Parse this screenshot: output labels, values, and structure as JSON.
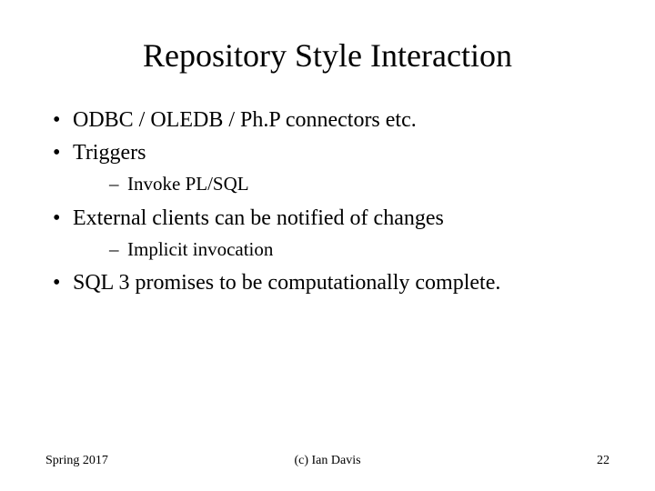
{
  "title": "Repository Style Interaction",
  "bullets": [
    {
      "text": "ODBC / OLEDB / Ph.P connectors etc.",
      "sub": []
    },
    {
      "text": "Triggers",
      "sub": [
        "Invoke PL/SQL"
      ]
    },
    {
      "text": "External clients can be notified of changes",
      "sub": [
        "Implicit invocation"
      ]
    },
    {
      "text": "SQL 3 promises to be computationally complete.",
      "sub": []
    }
  ],
  "footer": {
    "left": "Spring 2017",
    "center": "(c) Ian Davis",
    "right": "22"
  }
}
